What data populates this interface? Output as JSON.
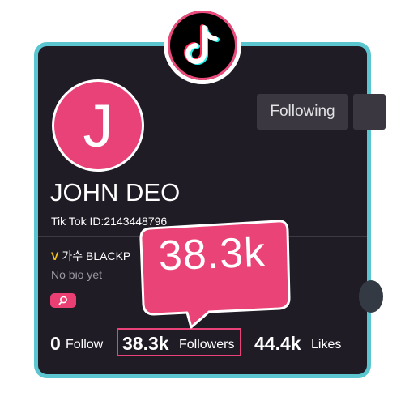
{
  "profile": {
    "avatar_letter": "J",
    "following_button_label": "Following",
    "name": "JOHN DEO",
    "tiktok_id": "Tik Tok ID:2143448796",
    "bio_badge": "V",
    "bio_text": "가수 BLACKP",
    "no_bio": "No bio yet"
  },
  "stats": {
    "follow_count": "0",
    "follow_label": "Follow",
    "followers_count": "38.3k",
    "followers_label": "Followers",
    "likes_count": "44.4k",
    "likes_label": "Likes"
  },
  "callout": {
    "text": "38.3k"
  },
  "icons": {
    "app_logo": "tiktok-logo-icon",
    "search": "search-icon",
    "more": "more-options-icon"
  },
  "colors": {
    "accent_pink": "#e94278",
    "frame_cyan": "#5cc6d0",
    "card_background": "#201c26",
    "badge_yellow": "#f2c21b"
  }
}
